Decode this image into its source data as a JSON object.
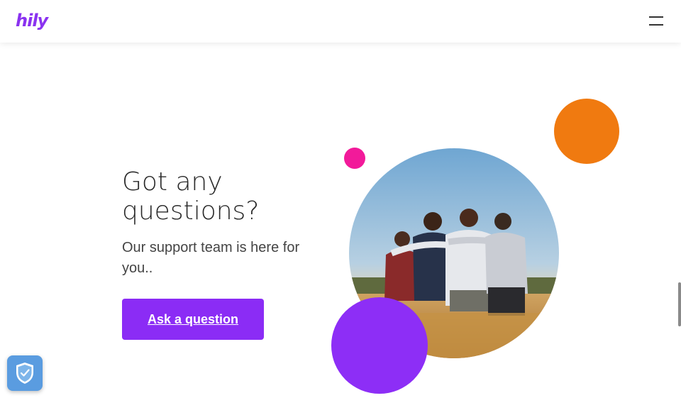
{
  "header": {
    "logo_text": "hily",
    "menu_icon": "hamburger-menu-icon"
  },
  "hero": {
    "heading_line1": "Got any",
    "heading_line2": "questions?",
    "subheading": "Our support team is here for you..",
    "cta_label": "Ask a question",
    "image_alt": "group-of-friends-in-field-photo"
  },
  "privacy_widget": {
    "icon": "shield-check-icon"
  },
  "colors": {
    "accent_purple": "#8b2cf5",
    "accent_orange": "#f07a10",
    "accent_pink": "#f21a9a",
    "shield_blue": "#5a9ce0"
  }
}
